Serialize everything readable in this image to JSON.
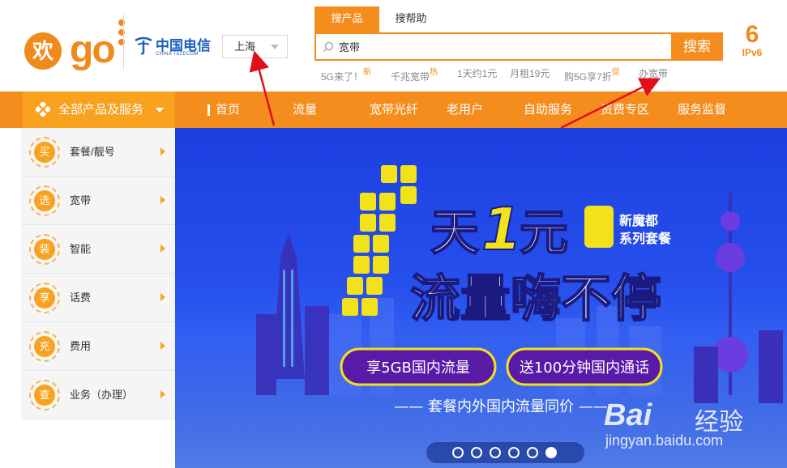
{
  "header": {
    "brand_left": "欢",
    "brand_right": "go",
    "telecom_cn": "中国电信",
    "telecom_en": "CHINA TELECOM",
    "city": "上海",
    "search_tabs": [
      "搜产品",
      "搜帮助"
    ],
    "search_value": "宽带",
    "search_button": "搜索",
    "hot_words": [
      {
        "text": "5G来了！",
        "tag": "新"
      },
      {
        "text": "千兆宽带",
        "tag": "热"
      },
      {
        "text": "1天约1元",
        "tag": ""
      },
      {
        "text": "月租19元",
        "tag": ""
      },
      {
        "text": "购5G享7折",
        "tag": "促"
      },
      {
        "text": "办宽带",
        "tag": ""
      }
    ],
    "ipv6_glyph": "6",
    "ipv6_label": "IPv6"
  },
  "nav": {
    "all_label": "全部产品及服务",
    "items": [
      "首页",
      "流量",
      "宽带光纤",
      "老用户",
      "自助服务",
      "资费专区",
      "服务监督"
    ]
  },
  "sidebar": {
    "items": [
      {
        "badge": "买",
        "label": "套餐/靓号"
      },
      {
        "badge": "选",
        "label": "宽带"
      },
      {
        "badge": "装",
        "label": "智能"
      },
      {
        "badge": "享",
        "label": "话费"
      },
      {
        "badge": "充",
        "label": "费用"
      },
      {
        "badge": "查",
        "label": "业务（办理）"
      }
    ]
  },
  "banner": {
    "headline_1": "天",
    "headline_num": "1",
    "headline_2": "元",
    "headline_big": "流量嗨不停",
    "tag_line_1": "新魔都",
    "tag_line_2": "系列套餐",
    "pill_1": "享5GB国内流量",
    "pill_2": "送100分钟国内通话",
    "subline": "—— 套餐内外国内流量同价 ——",
    "slide_count": 6,
    "active_slide": 6
  },
  "watermark": {
    "brand_1": "Bai",
    "brand_2": "经验",
    "url": "jingyan.baidu.com"
  },
  "colors": {
    "orange": "#f58d1e",
    "orange_light": "#f8a21f",
    "blue_brand": "#1e5fb8",
    "banner_blue": "#1f4be0",
    "yellow": "#f2e21a",
    "purple": "#5a1aa8",
    "annotation_red": "#e0101a"
  }
}
